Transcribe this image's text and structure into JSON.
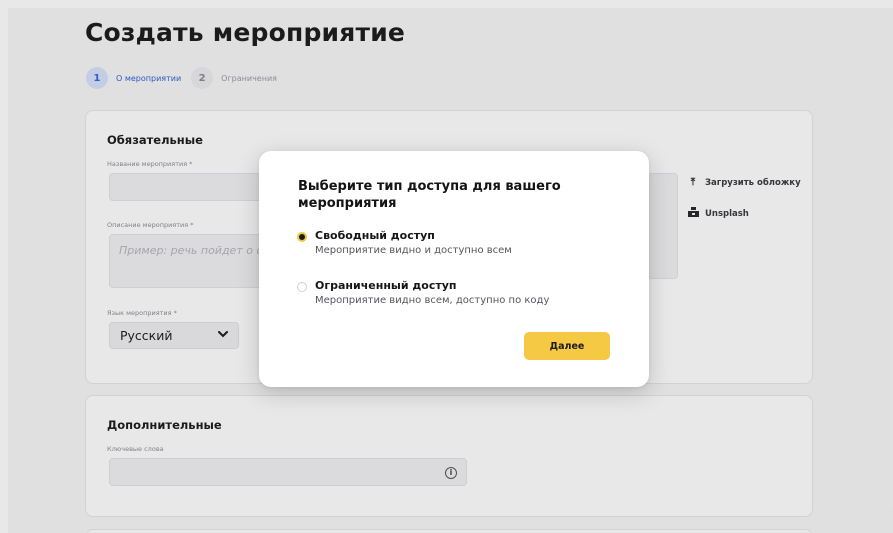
{
  "page": {
    "title": "Создать мероприятие"
  },
  "steps": [
    {
      "number": "1",
      "label": "О мероприятии",
      "active": true
    },
    {
      "number": "2",
      "label": "Ограничения",
      "active": false
    }
  ],
  "required_section": {
    "title": "Обязательные",
    "event_name_label": "Название мероприятия *",
    "event_name_value": "",
    "description_label": "Описание мероприятия *",
    "description_placeholder": "Пример: речь пойдет о ф",
    "language_label": "Язык мероприятия *",
    "language_value": "Русский",
    "cover_upload_label": "Загрузить обложку",
    "unsplash_label": "Unsplash"
  },
  "extra_section": {
    "title": "Дополнительные",
    "keywords_label": "Ключевые слова",
    "keywords_value": ""
  },
  "modal": {
    "title": "Выберите тип доступа для вашего мероприятия",
    "options": [
      {
        "title": "Свободный доступ",
        "description": "Мероприятие видно и доступно всем",
        "selected": true
      },
      {
        "title": "Ограниченный доступ",
        "description": "Мероприятие видно всем, доступно по коду",
        "selected": false
      }
    ],
    "next_label": "Далее"
  },
  "colors": {
    "accent_yellow": "#f6c945",
    "step_active_blue": "#2f5ed4",
    "backdrop": "#f7f7f8"
  },
  "icons": {
    "upload": "upload-icon",
    "unsplash": "unsplash-icon",
    "chevron": "chevron-down-icon",
    "info": "info-icon"
  }
}
